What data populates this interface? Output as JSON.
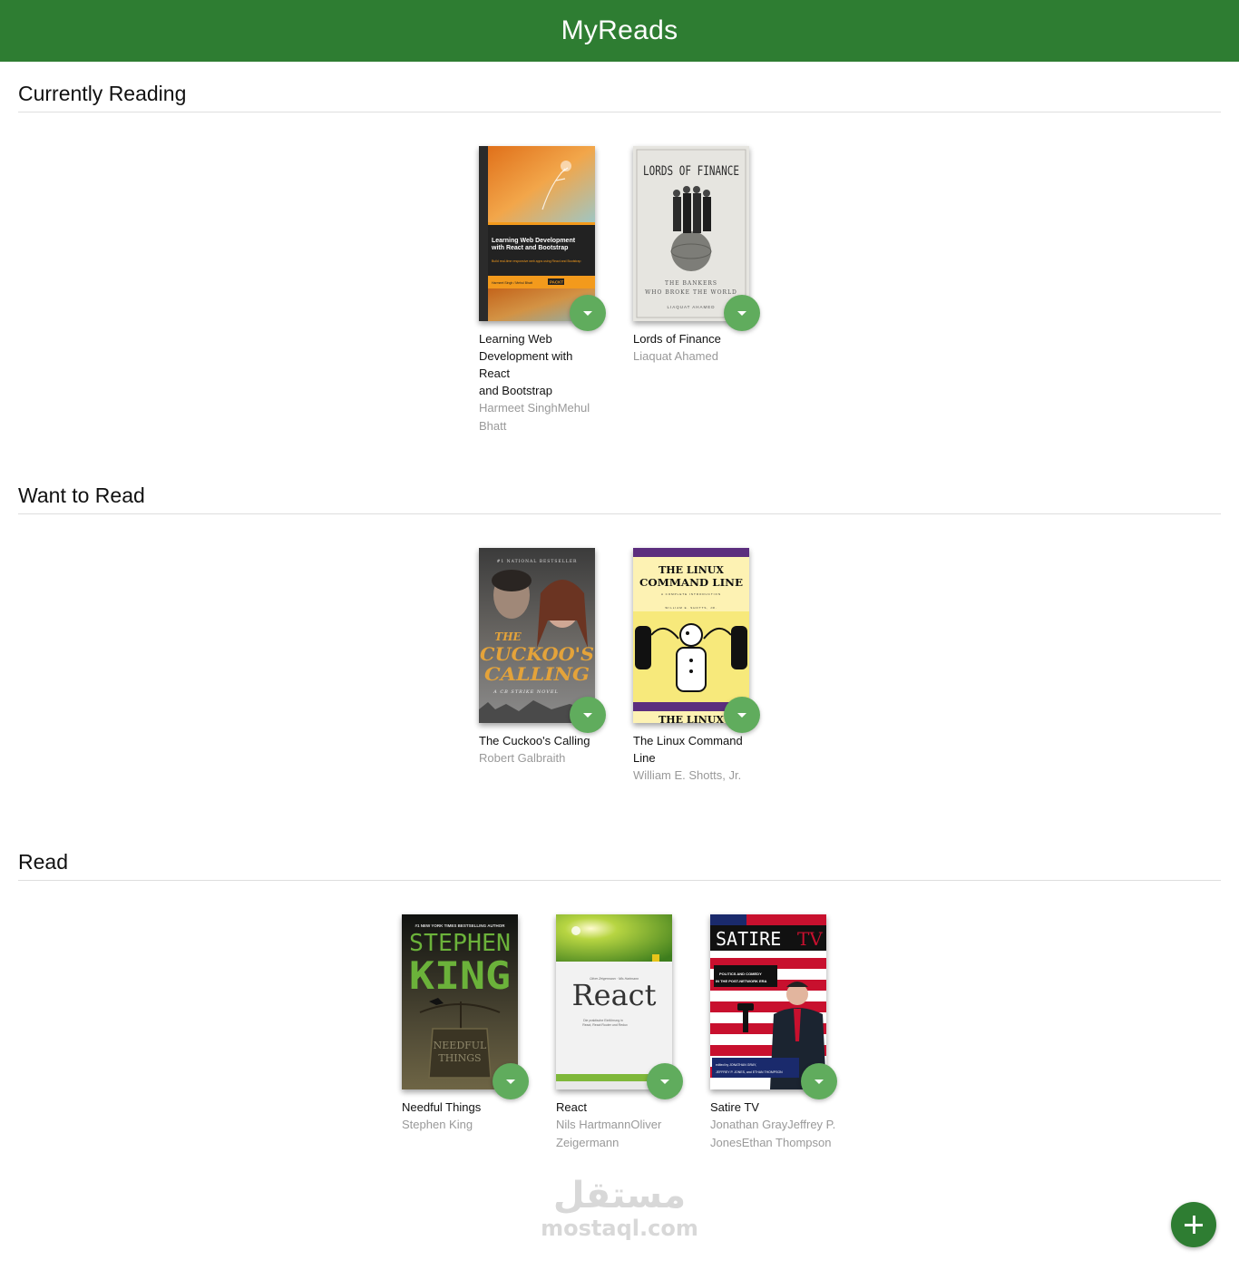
{
  "app": {
    "title": "MyReads"
  },
  "shelves": [
    {
      "title": "Currently Reading",
      "books": [
        {
          "title_lines": [
            "Learning Web",
            "Development with React",
            "and Bootstrap"
          ],
          "author_lines": [
            "Harmeet SinghMehul",
            "Bhatt"
          ],
          "cover": {
            "top": "Learning Web Development",
            "top2": "with React and Bootstrap",
            "sub": "Build real-time responsive web apps using React and Bootstrap",
            "authors": "Harmeet Singh / Mehul Bhatt",
            "publisher": "PACKT",
            "bar_text": "Community Experience Distilled"
          }
        },
        {
          "title_lines": [
            "Lords of Finance"
          ],
          "author_lines": [
            "Liaquat Ahamed"
          ],
          "cover": {
            "heading": "LORDS OF FINANCE",
            "line1": "THE BANKERS",
            "line2": "WHO BROKE THE WORLD",
            "author": "LIAQUAT AHAMED"
          }
        }
      ]
    },
    {
      "title": "Want to Read",
      "books": [
        {
          "title_lines": [
            "The Cuckoo's Calling"
          ],
          "author_lines": [
            "Robert Galbraith"
          ],
          "cover": {
            "banner": "#1 NATIONAL BESTSELLER",
            "line1": "THE",
            "line2": "CUCKOO'S",
            "line3": "CALLING",
            "tag": "A CB STRIKE NOVEL"
          }
        },
        {
          "title_lines": [
            "The Linux Command",
            "Line"
          ],
          "author_lines": [
            "William E. Shotts, Jr."
          ],
          "cover": {
            "line1": "THE LINUX",
            "line2": "COMMAND LINE",
            "sub": "A COMPLETE INTRODUCTION",
            "author": "WILLIAM E. SHOTTS, JR.",
            "bottom": "THE LINUX"
          }
        }
      ]
    },
    {
      "title": "Read",
      "books": [
        {
          "title_lines": [
            "Needful Things"
          ],
          "author_lines": [
            "Stephen King"
          ],
          "cover": {
            "banner": "#1 NEW YORK TIMES BESTSELLING AUTHOR",
            "line1": "STEPHEN",
            "line2": "KING",
            "sign1": "NEEDFUL",
            "sign2": "THINGS"
          }
        },
        {
          "title_lines": [
            "React"
          ],
          "author_lines": [
            "Nils HartmannOliver",
            "Zeigermann"
          ],
          "cover": {
            "authors": "Oliver Zeigermann · Nils Hartmann",
            "title": "React",
            "sub1": "Die praktische Einführung in",
            "sub2": "React, React Router und Redux"
          }
        },
        {
          "title_lines": [
            "Satire TV"
          ],
          "author_lines": [
            "Jonathan GrayJeffrey P.",
            "JonesEthan Thompson"
          ],
          "cover": {
            "title": "SATIRE",
            "title2": "TV",
            "sub1": "POLITICS AND COMEDY",
            "sub2": "IN THE POST-NETWORK ERA",
            "editors1": "edited by JONATHAN GRAY,",
            "editors2": "JEFFREY P. JONES, and ETHAN THOMPSON"
          }
        }
      ]
    }
  ],
  "watermark": {
    "arabic": "مستقل",
    "latin": "mostaql.com"
  },
  "colors": {
    "header": "#2e7d32",
    "changer": "#60ac5d",
    "add_button": "#2e7d32"
  },
  "icons": {
    "changer": "triangle-down-icon",
    "add": "plus-icon"
  }
}
